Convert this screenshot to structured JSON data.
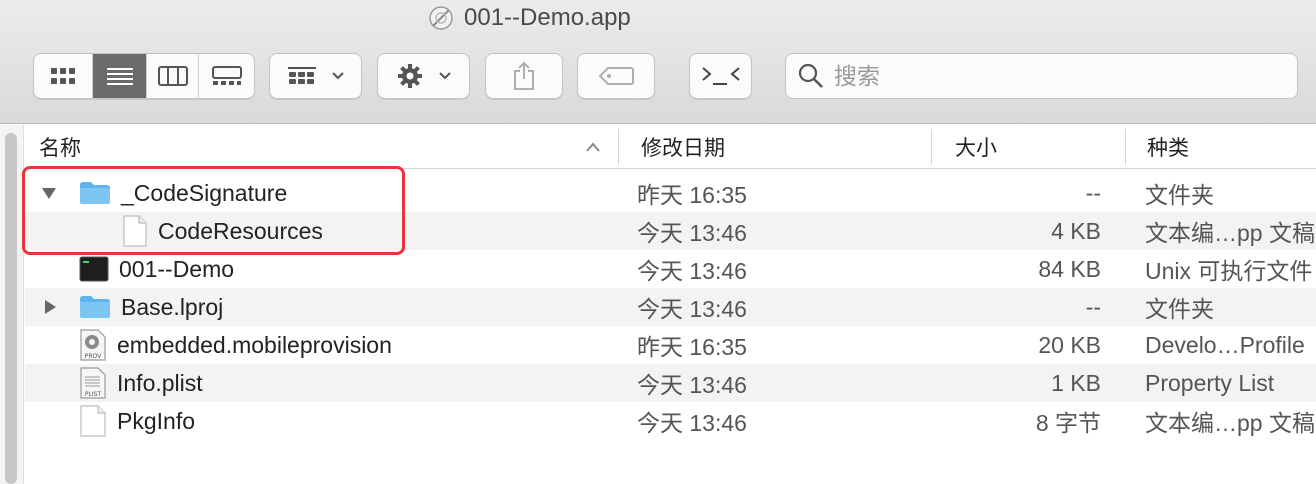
{
  "window": {
    "title": "001--Demo.app"
  },
  "search": {
    "placeholder": "搜索"
  },
  "columns": {
    "name": "名称",
    "date": "修改日期",
    "size": "大小",
    "kind": "种类"
  },
  "files": [
    {
      "name": "_CodeSignature",
      "date": "昨天 16:35",
      "size": "--",
      "kind": "文件夹",
      "icon": "folder-icon",
      "disclosure": "expanded",
      "indent": 0
    },
    {
      "name": "CodeResources",
      "date": "今天 13:46",
      "size": "4 KB",
      "kind": "文本编…pp 文稿",
      "icon": "document-icon",
      "disclosure": "none",
      "indent": 1
    },
    {
      "name": "001--Demo",
      "date": "今天 13:46",
      "size": "84 KB",
      "kind": "Unix 可执行文件",
      "icon": "terminal-exec-icon",
      "disclosure": "none",
      "indent": 0
    },
    {
      "name": "Base.lproj",
      "date": "今天 13:46",
      "size": "--",
      "kind": "文件夹",
      "icon": "folder-icon",
      "disclosure": "collapsed",
      "indent": 0
    },
    {
      "name": "embedded.mobileprovision",
      "date": "昨天 16:35",
      "size": "20 KB",
      "kind": "Develo…Profile",
      "icon": "provision-icon",
      "disclosure": "none",
      "indent": 0,
      "icon_label": "PROV"
    },
    {
      "name": "Info.plist",
      "date": "今天 13:46",
      "size": "1 KB",
      "kind": "Property List",
      "icon": "plist-icon",
      "disclosure": "none",
      "indent": 0,
      "icon_label": "PLIST"
    },
    {
      "name": "PkgInfo",
      "date": "今天 13:46",
      "size": "8 字节",
      "kind": "文本编…pp 文稿",
      "icon": "document-icon",
      "disclosure": "none",
      "indent": 0
    }
  ],
  "colors": {
    "highlight": "#e8343f",
    "folder": "#5db4ec",
    "active_view": "#6a6a6a"
  }
}
